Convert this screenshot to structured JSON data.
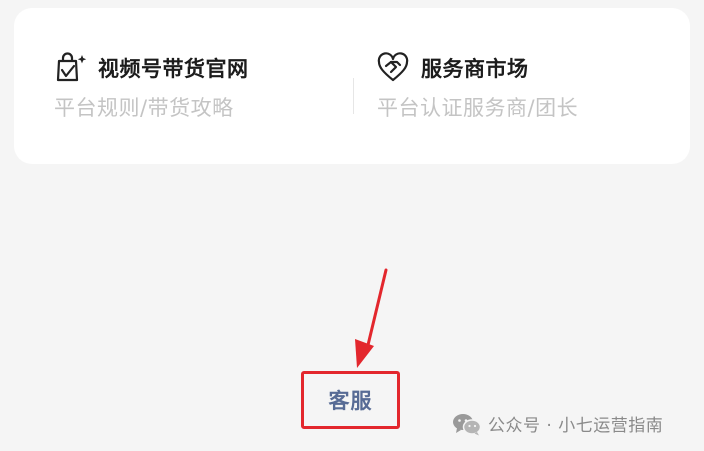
{
  "card": {
    "left_entry": {
      "icon": "shopping-bag-icon",
      "title": "视频号带货官网",
      "subtitle": "平台规则/带货攻略"
    },
    "right_entry": {
      "icon": "heart-handshake-icon",
      "title": "服务商市场",
      "subtitle": "平台认证服务商/团长"
    }
  },
  "footer": {
    "service_label": "客服",
    "highlight_color": "#e3272d",
    "link_color": "#576b95"
  },
  "watermark": {
    "icon": "wechat-icon",
    "text": "公众号 · 小七运营指南"
  }
}
